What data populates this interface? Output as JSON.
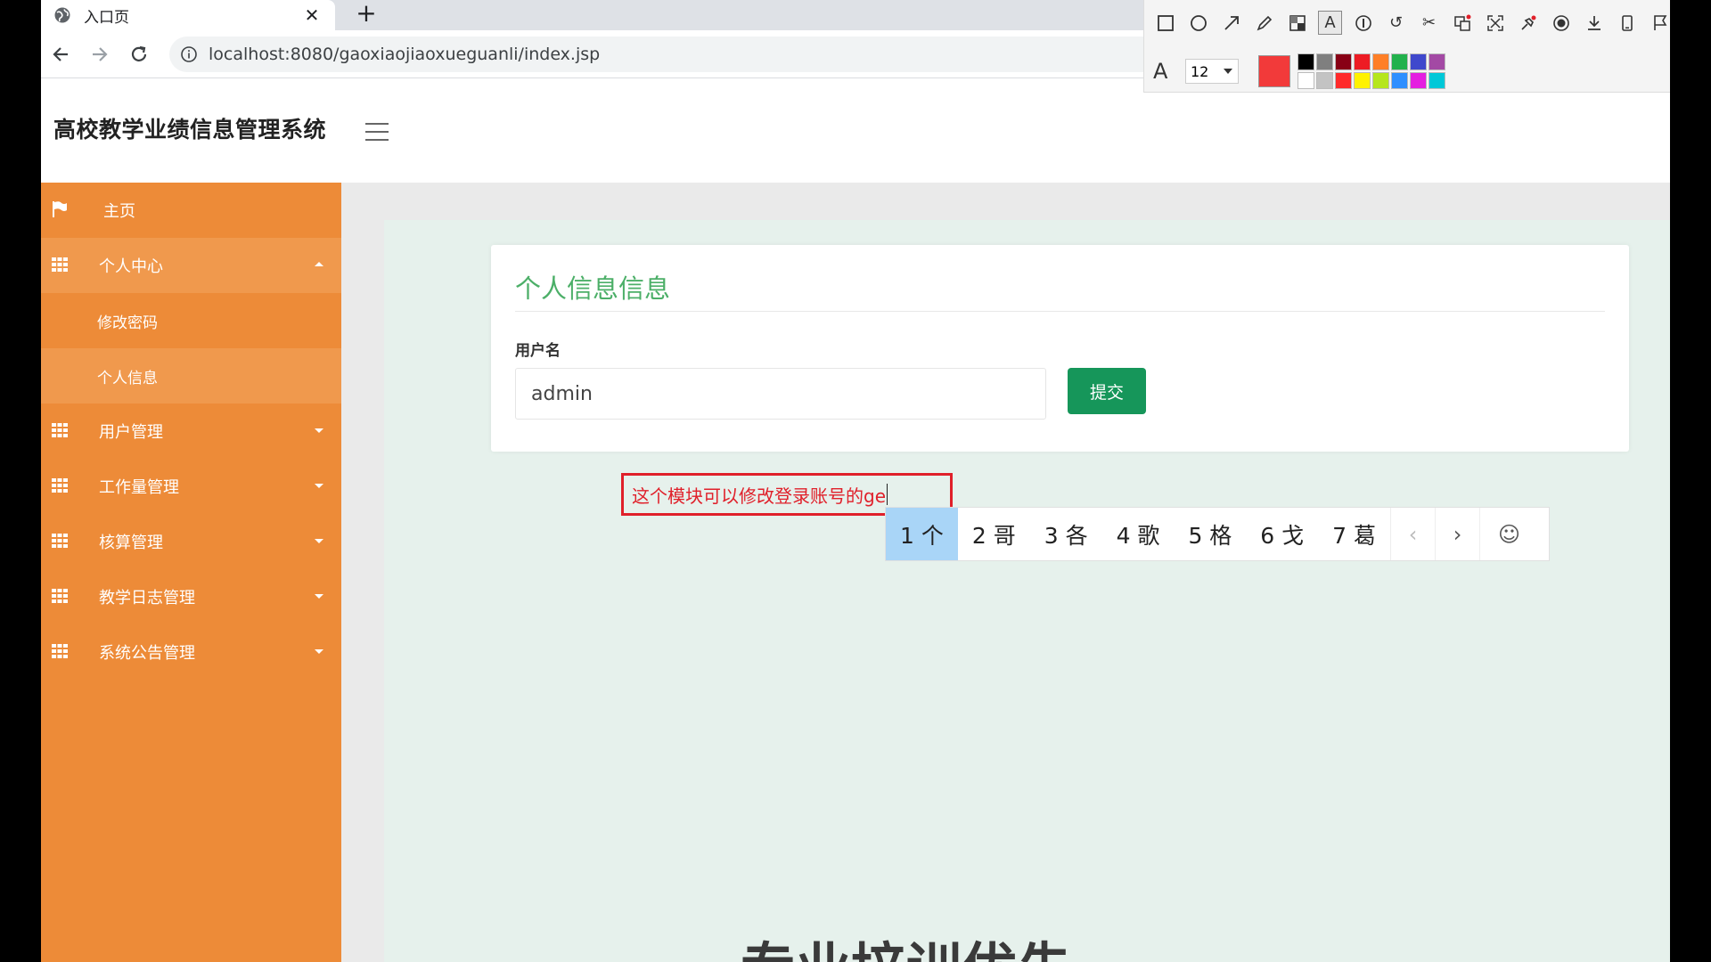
{
  "browser": {
    "tab_title": "入口页",
    "tab_close": "✕",
    "new_tab": "+",
    "url": "localhost:8080/gaoxiaojiaoxueguanli/index.jsp"
  },
  "app": {
    "system_title": "高校教学业绩信息管理系统"
  },
  "sidebar": {
    "items": [
      {
        "label": "主页"
      },
      {
        "label": "个人中心"
      },
      {
        "label": "修改密码"
      },
      {
        "label": "个人信息"
      },
      {
        "label": "用户管理"
      },
      {
        "label": "工作量管理"
      },
      {
        "label": "核算管理"
      },
      {
        "label": "教学日志管理"
      },
      {
        "label": "系统公告管理"
      }
    ]
  },
  "card": {
    "title": "个人信息信息",
    "username_label": "用户名",
    "username_value": "admin",
    "submit_label": "提交"
  },
  "annotation": {
    "text": "这个模块可以修改登录账号的ge"
  },
  "ime": {
    "candidates": [
      "1 个",
      "2 哥",
      "3 各",
      "4 歌",
      "5 格",
      "6 戈",
      "7 葛"
    ],
    "prev": "‹",
    "next": "›",
    "emoji": "☺"
  },
  "tool": {
    "font_size": "12",
    "current_color": "#f23a3a",
    "palette": [
      "#000000",
      "#7f7f7f",
      "#880015",
      "#ed1c24",
      "#ff7f27",
      "#22b14c",
      "#3f48cc",
      "#a349a4",
      "#ffffff",
      "#c3c3c3",
      "#ff2a2a",
      "#fff200",
      "#b5e61d",
      "#2f8fff",
      "#e41fe0",
      "#00c8d8"
    ]
  },
  "background_text": "专业培训优先"
}
